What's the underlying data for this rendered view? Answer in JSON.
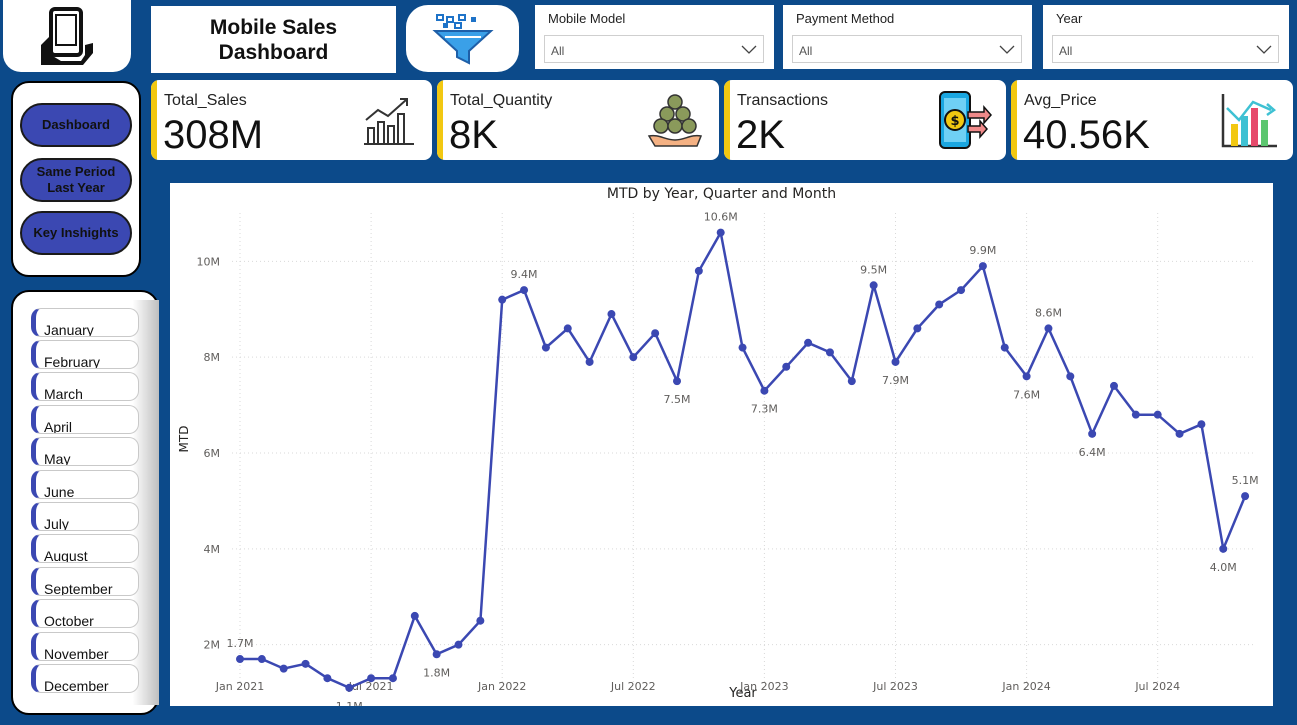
{
  "header": {
    "title_line1": "Mobile Sales",
    "title_line2": "Dashboard"
  },
  "icons": {
    "logo": "mobile-phone-hand-icon",
    "filter": "funnel-filter-icon"
  },
  "filters": [
    {
      "label": "Mobile Model",
      "value": "All"
    },
    {
      "label": "Payment Method",
      "value": "All"
    },
    {
      "label": "Year",
      "value": "All"
    }
  ],
  "kpis": [
    {
      "label": "Total_Sales",
      "value": "308M",
      "icon": "line-chart-growth-icon"
    },
    {
      "label": "Total_Quantity",
      "value": "8K",
      "icon": "coins-hand-icon"
    },
    {
      "label": "Transactions",
      "value": "2K",
      "icon": "phone-payment-icon"
    },
    {
      "label": "Avg_Price",
      "value": "40.56K",
      "icon": "bar-chart-icon"
    }
  ],
  "nav": [
    {
      "label": "Dashboard"
    },
    {
      "label": "Same Period Last Year"
    },
    {
      "label": "Key Inshights"
    }
  ],
  "months": [
    "January",
    "February",
    "March",
    "April",
    "May",
    "June",
    "July",
    "August",
    "September",
    "October",
    "November",
    "December"
  ],
  "colors": {
    "background": "#0c4a8a",
    "accent": "#3b48b2",
    "kpi_bar": "#f2c811",
    "line": "#3b48b2"
  },
  "chart_data": {
    "type": "line",
    "title": "MTD by Year, Quarter and Month",
    "xlabel": "Year",
    "ylabel": "MTD",
    "x_ticks": [
      "Jan 2021",
      "Jul 2021",
      "Jan 2022",
      "Jul 2022",
      "Jan 2023",
      "Jul 2023",
      "Jan 2024",
      "Jul 2024"
    ],
    "y_ticks": [
      "2M",
      "4M",
      "6M",
      "8M",
      "10M"
    ],
    "ylim": [
      1.2,
      10.8
    ],
    "grid": true,
    "series": [
      {
        "values": [
          1.7,
          1.7,
          1.5,
          1.6,
          1.3,
          1.1,
          1.3,
          1.3,
          2.6,
          1.8,
          2.0,
          2.5,
          9.2,
          9.4,
          8.2,
          8.6,
          7.9,
          8.9,
          8.0,
          8.5,
          7.5,
          9.8,
          10.6,
          8.2,
          7.3,
          7.8,
          8.3,
          8.1,
          7.5,
          9.5,
          7.9,
          8.6,
          9.1,
          9.4,
          9.9,
          8.2,
          7.6,
          8.6,
          7.6,
          6.4,
          7.4,
          6.8,
          6.8,
          6.4,
          6.6,
          4.0,
          5.1
        ]
      }
    ],
    "data_labels": [
      {
        "index": 0,
        "text": "1.7M"
      },
      {
        "index": 5,
        "text": "1.1M"
      },
      {
        "index": 9,
        "text": "1.8M"
      },
      {
        "index": 13,
        "text": "9.4M"
      },
      {
        "index": 20,
        "text": "7.5M"
      },
      {
        "index": 22,
        "text": "10.6M"
      },
      {
        "index": 24,
        "text": "7.3M"
      },
      {
        "index": 29,
        "text": "9.5M"
      },
      {
        "index": 30,
        "text": "7.9M"
      },
      {
        "index": 34,
        "text": "9.9M"
      },
      {
        "index": 36,
        "text": "7.6M"
      },
      {
        "index": 37,
        "text": "8.6M"
      },
      {
        "index": 39,
        "text": "6.4M"
      },
      {
        "index": 45,
        "text": "4.0M"
      },
      {
        "index": 46,
        "text": "5.1M"
      }
    ]
  }
}
